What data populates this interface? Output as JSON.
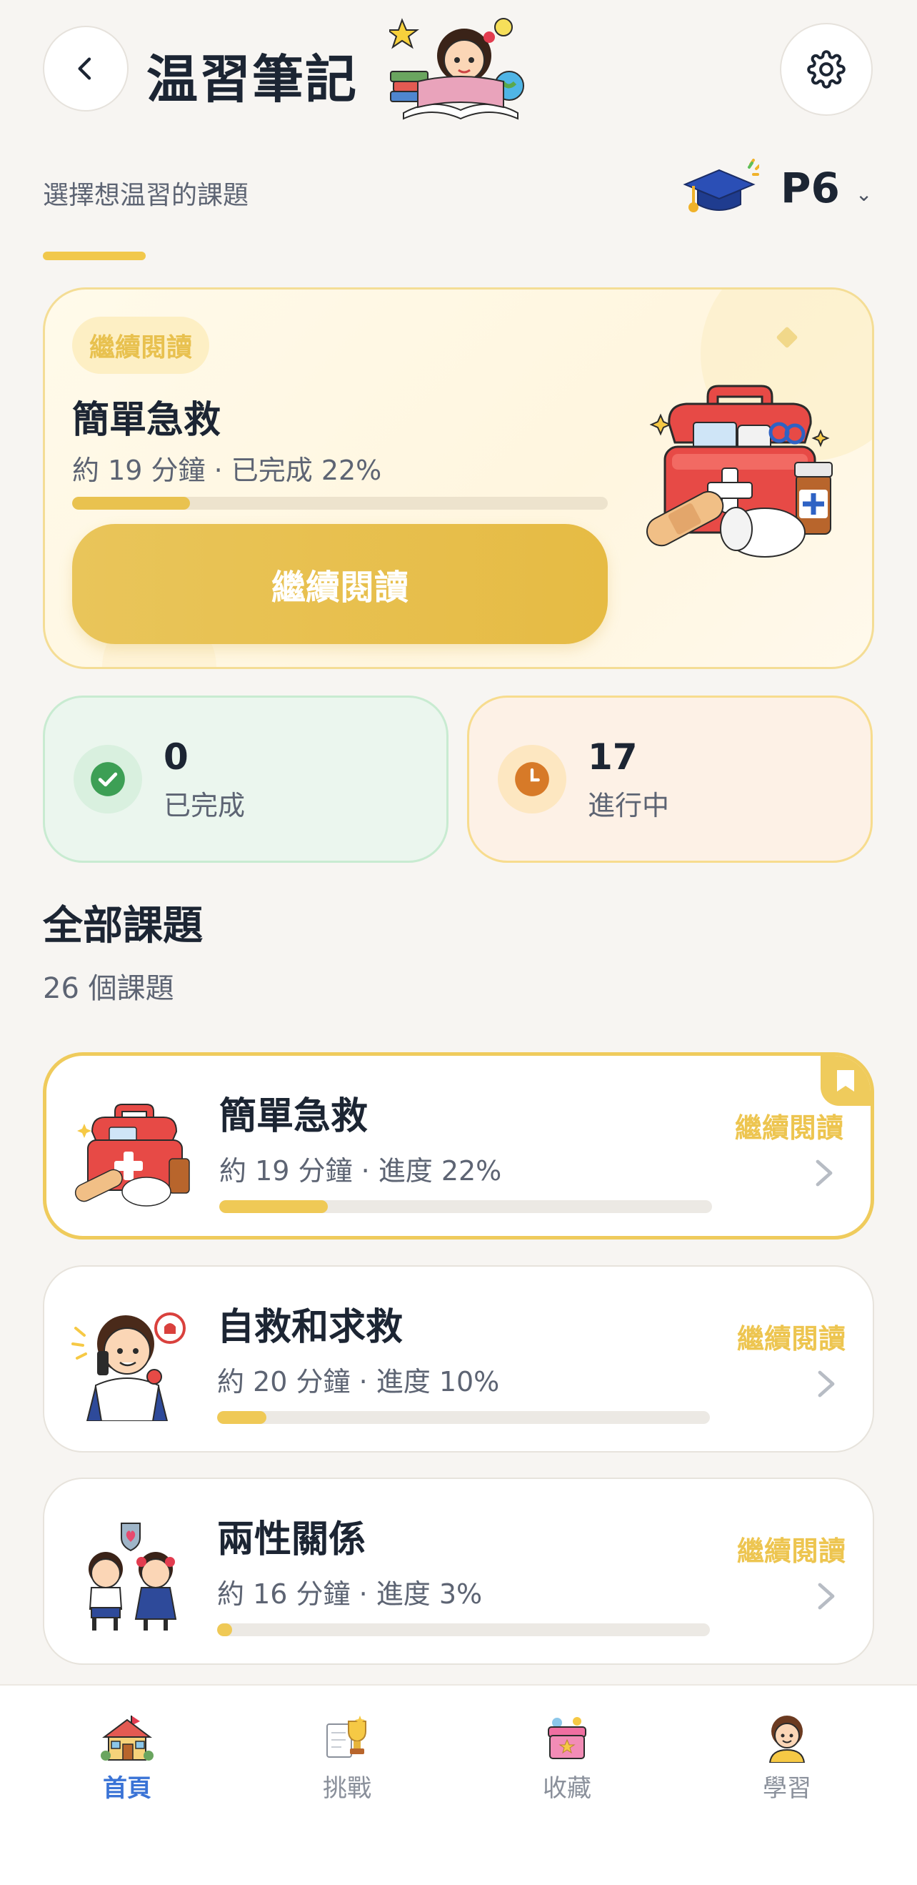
{
  "header": {
    "title": "温習筆記",
    "subtitle": "選擇想温習的課題",
    "grade": "P6",
    "grade_chevron": "⌄"
  },
  "continue_card": {
    "badge": "繼續閱讀",
    "title": "簡單急救",
    "meta": "約 19 分鐘 · 已完成 22%",
    "progress": 0.22,
    "button": "繼續閱讀"
  },
  "stats": {
    "done": {
      "value": "0",
      "label": "已完成"
    },
    "in_progress": {
      "value": "17",
      "label": "進行中"
    }
  },
  "section": {
    "title": "全部課題",
    "count": "26 個課題"
  },
  "topics": [
    {
      "name": "簡單急救",
      "meta": "約 19 分鐘 · 進度 22%",
      "progress": 0.22,
      "action": "繼續閱讀",
      "icon": "first-aid-kit-icon",
      "active": true
    },
    {
      "name": "自救和求救",
      "meta": "約 20 分鐘 · 進度 10%",
      "progress": 0.1,
      "action": "繼續閱讀",
      "icon": "boy-calling-icon",
      "active": false
    },
    {
      "name": "兩性關係",
      "meta": "約 16 分鐘 · 進度 3%",
      "progress": 0.03,
      "action": "繼續閱讀",
      "icon": "boy-girl-icon",
      "active": false
    }
  ],
  "nav": {
    "items": [
      {
        "label": "首頁",
        "icon": "house-icon",
        "active": true
      },
      {
        "label": "挑戰",
        "icon": "trophy-icon",
        "active": false
      },
      {
        "label": "收藏",
        "icon": "treasure-box-icon",
        "active": false
      },
      {
        "label": "學習",
        "icon": "student-icon",
        "active": false
      }
    ]
  },
  "colors": {
    "accent": "#efc956",
    "nav_active": "#3a73d6",
    "success": "#3d9f55",
    "warning": "#d77a28"
  }
}
